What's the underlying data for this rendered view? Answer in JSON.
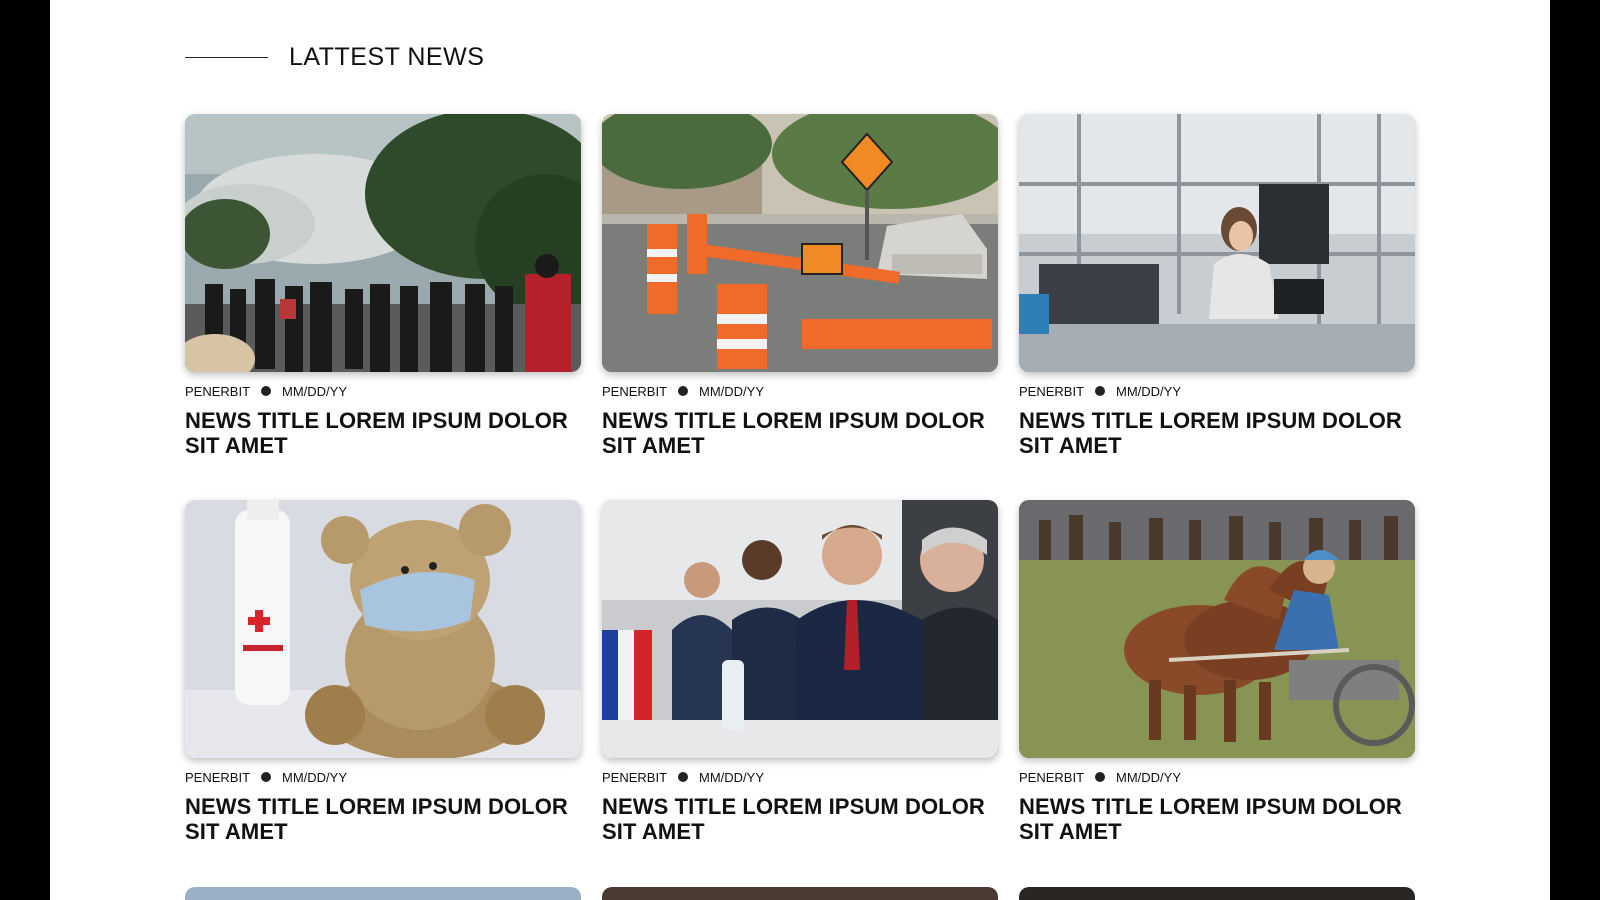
{
  "section": {
    "title": "LATTEST NEWS"
  },
  "cards": [
    {
      "author": "PENERBIT",
      "date": "MM/DD/YY",
      "title": "NEWS TITLE LOREM IPSUM DOLOR SIT AMET",
      "image_icon": "protest-crowd-photo"
    },
    {
      "author": "PENERBIT",
      "date": "MM/DD/YY",
      "title": "NEWS TITLE LOREM IPSUM DOLOR SIT AMET",
      "image_icon": "road-construction-photo"
    },
    {
      "author": "PENERBIT",
      "date": "MM/DD/YY",
      "title": "NEWS TITLE LOREM IPSUM DOLOR SIT AMET",
      "image_icon": "engineer-lab-photo"
    },
    {
      "author": "PENERBIT",
      "date": "MM/DD/YY",
      "title": "NEWS TITLE LOREM IPSUM DOLOR SIT AMET",
      "image_icon": "teddy-bear-mask-photo"
    },
    {
      "author": "PENERBIT",
      "date": "MM/DD/YY",
      "title": "NEWS TITLE LOREM IPSUM DOLOR SIT AMET",
      "image_icon": "press-conference-photo"
    },
    {
      "author": "PENERBIT",
      "date": "MM/DD/YY",
      "title": "NEWS TITLE LOREM IPSUM DOLOR SIT AMET",
      "image_icon": "horse-cart-race-photo"
    }
  ],
  "colors": {
    "page_bg": "#ffffff",
    "frame": "#000000",
    "text": "#111111"
  }
}
